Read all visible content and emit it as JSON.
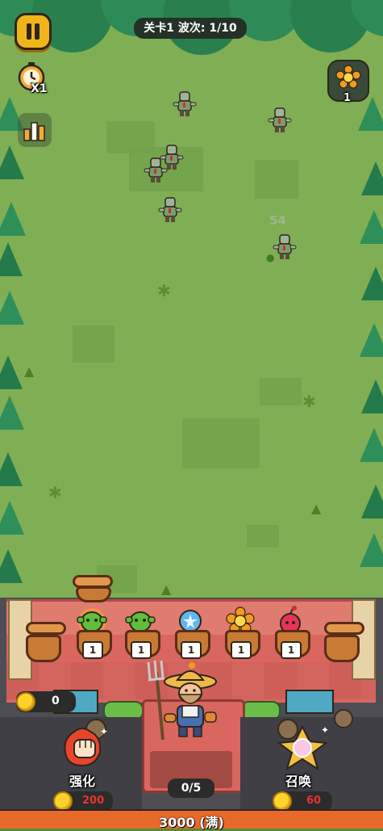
{
  "hud": {
    "level_wave": "关卡1 波次: 1/10",
    "speed_label": "X1",
    "flower_count": "1"
  },
  "field": {
    "damage_number": "54"
  },
  "slots": [
    {
      "plant": "peashooter",
      "level": "1"
    },
    {
      "plant": "peashooter",
      "level": "1"
    },
    {
      "plant": "ice-orb",
      "level": "1"
    },
    {
      "plant": "sunflower",
      "level": "1"
    },
    {
      "plant": "cherry-bomb",
      "level": "1"
    }
  ],
  "bottom": {
    "coins": "0",
    "upgrade_label": "强化",
    "upgrade_cost": "200",
    "summon_label": "召唤",
    "summon_cost": "60",
    "unit_count": "0/5",
    "total": "3000 (满)"
  },
  "colors": {
    "accent": "#f1b51c",
    "cost_red": "#e8342c",
    "grass": "#7fae55",
    "wall": "#d9665f"
  }
}
